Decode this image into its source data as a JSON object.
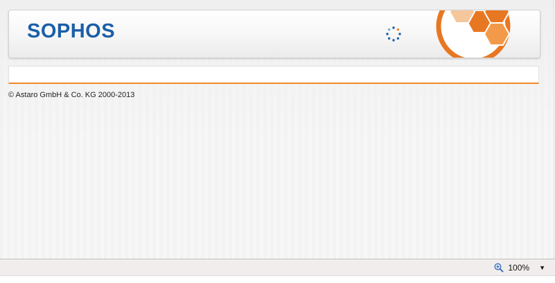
{
  "header": {
    "logo_text": "SOPHOS",
    "brand_color": "#1b5fa8",
    "accent_color": "#f08a24",
    "loading_indicator": "spinner-icon",
    "brand_graphic": "hexagon-circle-icon"
  },
  "footer": {
    "copyright": "© Astaro GmbH & Co. KG 2000-2013"
  },
  "statusbar": {
    "zoom_level": "100%",
    "zoom_icon": "magnifier-zoom-icon",
    "dropdown_icon": "chevron-down-icon"
  }
}
